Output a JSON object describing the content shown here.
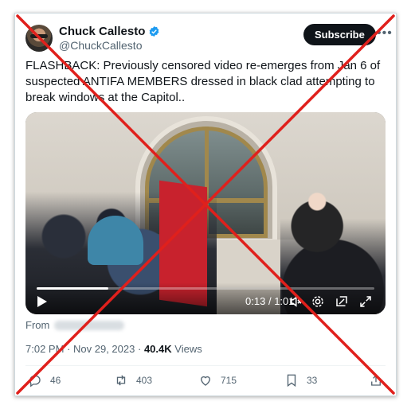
{
  "author": {
    "display_name": "Chuck Callesto",
    "handle": "@ChuckCallesto",
    "verified": true
  },
  "header": {
    "subscribe_label": "Subscribe",
    "more_icon": "more-horizontal-icon"
  },
  "tweet": {
    "text": "FLASHBACK: Previously censored video re-emerges from Jan 6 of suspected ANTIFA MEMBERS dressed in black clad attempting to break windows at the Capitol.."
  },
  "video": {
    "current_time": "0:13",
    "duration": "1:01",
    "progress": 0.213,
    "icons": [
      "play-icon",
      "volume-icon",
      "settings-icon",
      "pip-icon",
      "fullscreen-icon"
    ]
  },
  "source": {
    "label": "From"
  },
  "meta": {
    "time": "7:02 PM",
    "separator": "·",
    "date": "Nov 29, 2023",
    "views_count": "40.4K",
    "views_label": "Views"
  },
  "actions": {
    "replies": "46",
    "reposts": "403",
    "likes": "715",
    "bookmarks": "33"
  },
  "colors": {
    "accent": "#1d9bf0",
    "cross": "#e0201c",
    "text_secondary": "#536471"
  }
}
